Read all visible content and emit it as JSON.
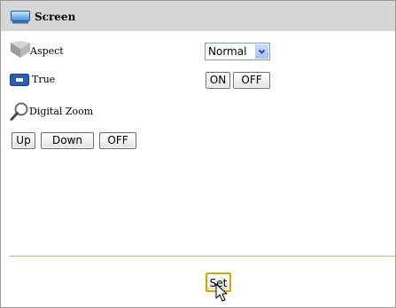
{
  "section": {
    "title": "Screen",
    "icon": "monitor-icon"
  },
  "aspect": {
    "label": "Aspect",
    "icon": "aspect-icon",
    "selected": "Normal",
    "select_icon": "chevron-down-icon"
  },
  "true_setting": {
    "label": "True",
    "icon": "screen-true-icon",
    "on_label": "ON",
    "off_label": "OFF"
  },
  "digital_zoom": {
    "label": "Digital Zoom",
    "icon": "magnifier-icon",
    "up_label": "Up",
    "down_label": "Down",
    "off_label": "OFF"
  },
  "footer": {
    "set_label": "Set",
    "cursor_icon": "mouse-pointer-icon"
  },
  "colors": {
    "header_bg": "#d6d6d6",
    "frame_border": "#9a9a9a",
    "divider": "#c8b48a",
    "set_button_border": "#d9a400"
  }
}
